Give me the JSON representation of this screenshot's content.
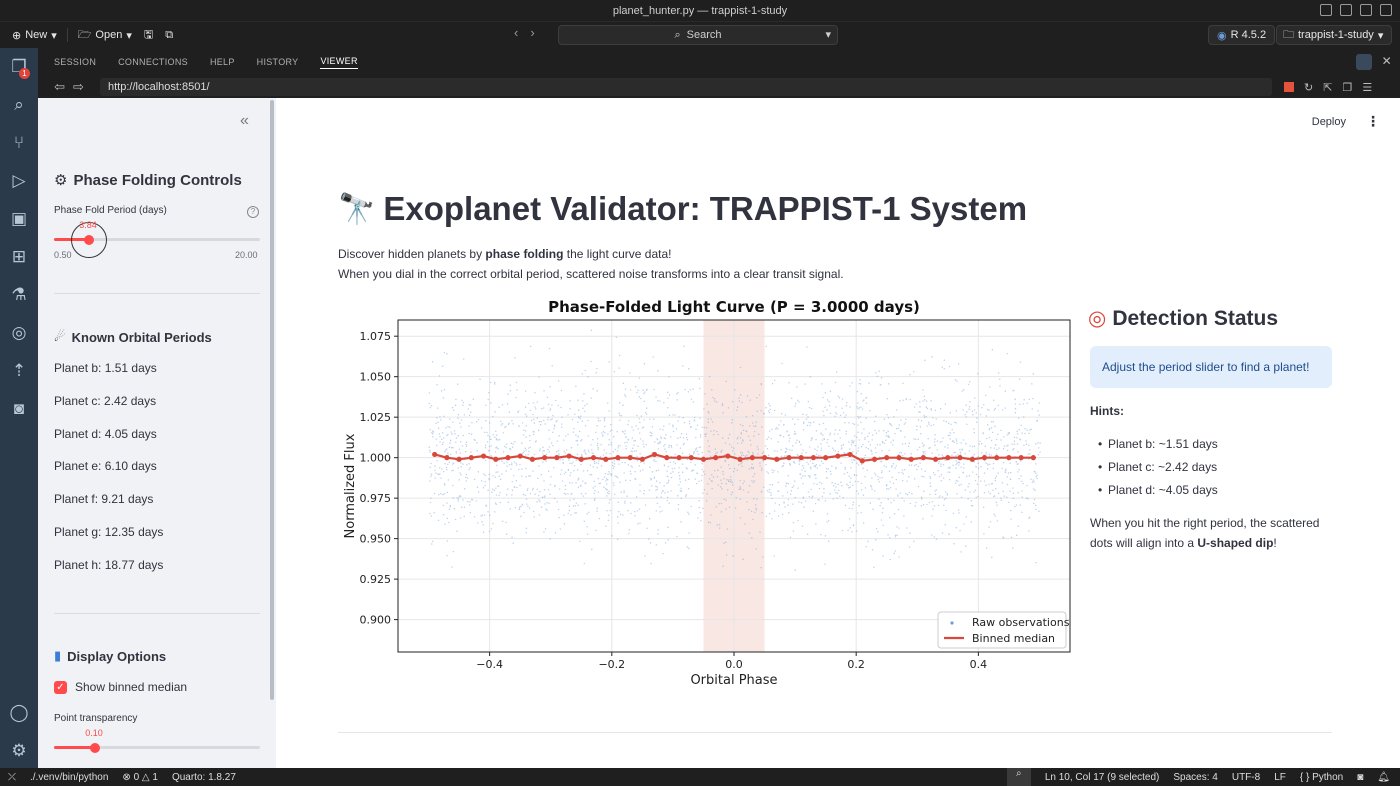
{
  "window": {
    "title": "planet_hunter.py — trappist-1-study"
  },
  "toolbar": {
    "new_label": "New",
    "open_label": "Open",
    "search_label": "Search",
    "r_version": "R 4.5.2",
    "project": "trappist-1-study"
  },
  "activity": {
    "badge_count": "1"
  },
  "panel_tabs": [
    "SESSION",
    "CONNECTIONS",
    "HELP",
    "HISTORY",
    "VIEWER"
  ],
  "url": "http://localhost:8501/",
  "sidebar": {
    "controls_heading": "Phase Folding Controls",
    "slider_label": "Phase Fold Period (days)",
    "slider_value": "3.84",
    "slider_min": "0.50",
    "slider_max": "20.00",
    "slider_fraction": 0.171,
    "periods_heading": "Known Orbital Periods",
    "periods": [
      "Planet b: 1.51 days",
      "Planet c: 2.42 days",
      "Planet d: 4.05 days",
      "Planet e: 6.10 days",
      "Planet f: 9.21 days",
      "Planet g: 12.35 days",
      "Planet h: 18.77 days"
    ],
    "display_heading": "Display Options",
    "checkbox_label": "Show binned median",
    "checkbox_checked": true,
    "transparency_label": "Point transparency",
    "transparency_value": "0.10",
    "transparency_fraction": 0.2
  },
  "main": {
    "deploy_label": "Deploy",
    "title": "Exoplanet Validator: TRAPPIST-1 System",
    "intro_pre": "Discover hidden planets by ",
    "intro_bold": "phase folding",
    "intro_post": " the light curve data!",
    "intro_line2": "When you dial in the correct orbital period, scattered noise transforms into a clear transit signal.",
    "status_heading": "Detection Status",
    "info_message": "Adjust the period slider to find a planet!",
    "hints_heading": "Hints:",
    "hints": [
      "Planet b: ~1.51 days",
      "Planet c: ~2.42 days",
      "Planet d: ~4.05 days"
    ],
    "foot_pre": "When you hit the right period, the scattered dots will align into a ",
    "foot_bold": "U-shaped dip",
    "foot_post": "!"
  },
  "chart_data": {
    "type": "scatter",
    "title": "Phase-Folded Light Curve (P = 3.0000 days)",
    "xlabel": "Orbital Phase",
    "ylabel": "Normalized Flux",
    "xlim": [
      -0.55,
      0.55
    ],
    "ylim": [
      0.88,
      1.085
    ],
    "xticks": [
      -0.4,
      -0.2,
      0.0,
      0.2,
      0.4
    ],
    "xtick_labels": [
      "−0.4",
      "−0.2",
      "0.0",
      "0.2",
      "0.4"
    ],
    "yticks": [
      0.9,
      0.925,
      0.95,
      0.975,
      1.0,
      1.025,
      1.05,
      1.075
    ],
    "ytick_labels": [
      "0.900",
      "0.925",
      "0.950",
      "0.975",
      "1.000",
      "1.025",
      "1.050",
      "1.075"
    ],
    "transit_band": [
      -0.05,
      0.05
    ],
    "grid": true,
    "legend_position": "bottom-right",
    "series": [
      {
        "name": "Raw observations",
        "kind": "scatter",
        "color": "#6fa0d8",
        "x_range": [
          -0.5,
          0.5
        ],
        "center": 1.0,
        "spread": 0.025
      },
      {
        "name": "Binned median",
        "kind": "line",
        "color": "#d9493b",
        "x": [
          -0.49,
          -0.47,
          -0.45,
          -0.43,
          -0.41,
          -0.39,
          -0.37,
          -0.35,
          -0.33,
          -0.31,
          -0.29,
          -0.27,
          -0.25,
          -0.23,
          -0.21,
          -0.19,
          -0.17,
          -0.15,
          -0.13,
          -0.11,
          -0.09,
          -0.07,
          -0.05,
          -0.03,
          -0.01,
          0.01,
          0.03,
          0.05,
          0.07,
          0.09,
          0.11,
          0.13,
          0.15,
          0.17,
          0.19,
          0.21,
          0.23,
          0.25,
          0.27,
          0.29,
          0.31,
          0.33,
          0.35,
          0.37,
          0.39,
          0.41,
          0.43,
          0.45,
          0.47,
          0.49
        ],
        "y": [
          1.002,
          1.0,
          0.999,
          1.0,
          1.001,
          0.999,
          1.0,
          1.001,
          0.999,
          1.0,
          1.0,
          1.001,
          0.999,
          1.0,
          0.999,
          1.0,
          1.0,
          0.999,
          1.002,
          1.0,
          1.0,
          1.0,
          0.999,
          1.0,
          1.001,
          0.999,
          1.0,
          1.0,
          0.999,
          1.0,
          1.0,
          1.0,
          1.0,
          1.001,
          1.002,
          0.998,
          0.999,
          1.0,
          1.0,
          0.999,
          1.0,
          0.999,
          1.0,
          1.0,
          0.999,
          1.0,
          1.0,
          1.0,
          1.0,
          1.0
        ]
      }
    ]
  },
  "statusbar": {
    "interpreter": "./.venv/bin/python",
    "errors": "0",
    "warnings": "1",
    "quarto": "Quarto: 1.8.27",
    "cursor": "Ln 10, Col 17 (9 selected)",
    "spaces": "Spaces: 4",
    "encoding": "UTF-8",
    "eol": "LF",
    "language": "Python"
  }
}
